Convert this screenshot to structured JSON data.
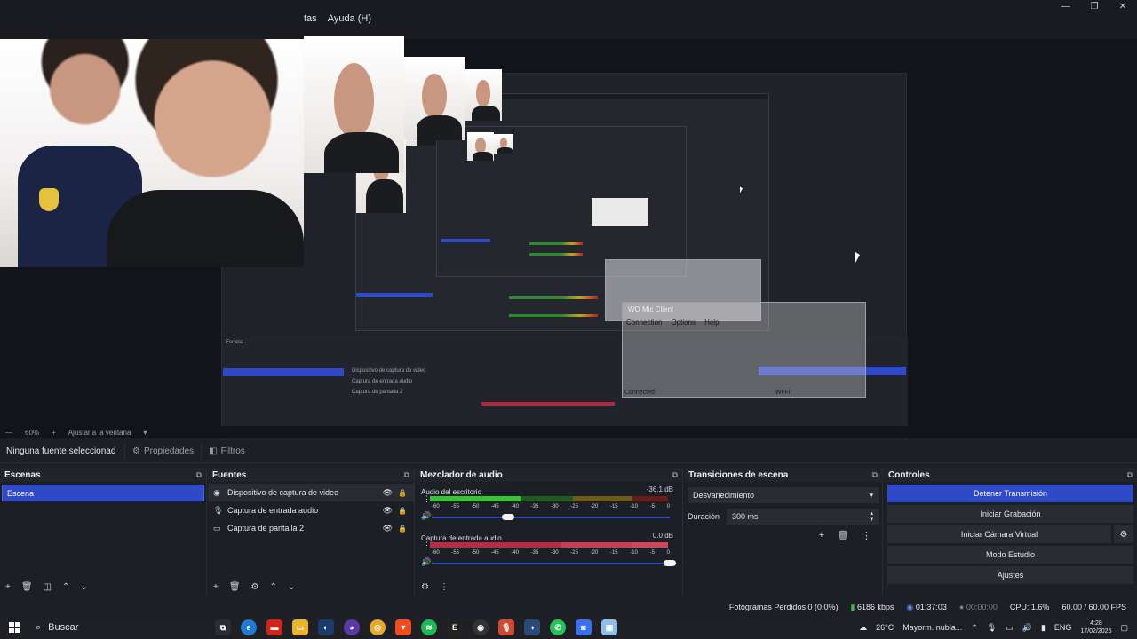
{
  "menu": {
    "items": [
      "tas",
      "Ayuda (H)"
    ]
  },
  "window_controls": {
    "minimize": "—",
    "maximize": "❐",
    "close": "✕"
  },
  "preview": {
    "nested_labels": {
      "dialog_title": "WO Mic Client",
      "dialog_menu": [
        "Connection",
        "Options",
        "Help"
      ],
      "dialog_status": "Connected",
      "dialog_wifi": "Wi-Fi",
      "nested_scene": "Escena",
      "nested_sources": [
        "Dispositivo de captura de video",
        "Captura de entrada audio",
        "Captura de pantalla 2"
      ]
    }
  },
  "zoombar": {
    "zoom": "60%",
    "fit": "Ajustar a la ventana"
  },
  "propbar": {
    "selection": "Ninguna fuente seleccionad",
    "properties_label": "Propiedades",
    "filters_label": "Filtros"
  },
  "scenes": {
    "title": "Escenas",
    "items": [
      "Escena"
    ]
  },
  "sources": {
    "title": "Fuentes",
    "items": [
      {
        "label": "Dispositivo de captura de video",
        "icon": "camera-icon"
      },
      {
        "label": "Captura de entrada audio",
        "icon": "microphone-icon"
      },
      {
        "label": "Captura de pantalla 2",
        "icon": "monitor-icon"
      }
    ]
  },
  "mixer": {
    "title": "Mezclador de audio",
    "tracks": [
      {
        "name": "Audio del escritorio",
        "db": "-36.1 dB",
        "volume": 0.32,
        "level": 0.38
      },
      {
        "name": "Captura de entrada audio",
        "db": "0.0 dB",
        "volume": 1.0,
        "level": 0.0
      }
    ],
    "scale": [
      "-60",
      "-55",
      "-50",
      "-45",
      "-40",
      "-35",
      "-30",
      "-25",
      "-20",
      "-15",
      "-10",
      "-5",
      "0"
    ]
  },
  "transitions": {
    "title": "Transiciones de escena",
    "selected": "Desvanecimiento",
    "duration_label": "Duración",
    "duration_value": "300 ms"
  },
  "controls": {
    "title": "Controles",
    "stop_stream": "Detener Transmisión",
    "start_recording": "Iniciar Grabación",
    "start_virtual_cam": "Iniciar Cámara Virtual",
    "studio_mode": "Modo Estudio",
    "settings": "Ajustes"
  },
  "status": {
    "dropped_frames": "Fotogramas Perdidos 0 (0.0%)",
    "bitrate": "6186 kbps",
    "stream_time": "01:37:03",
    "rec_time": "00:00:00",
    "cpu": "CPU: 1.6%",
    "fps": "60.00 / 60.00 FPS"
  },
  "taskbar": {
    "search": "Buscar",
    "weather": "26°C",
    "weather_text": "Mayorm. nubla...",
    "lang": "ENG",
    "time": "4:28",
    "date": "17/02/2026"
  },
  "colors": {
    "accent": "#2f49c8",
    "bg": "#1d1f26",
    "panel": "#2a2c34"
  }
}
